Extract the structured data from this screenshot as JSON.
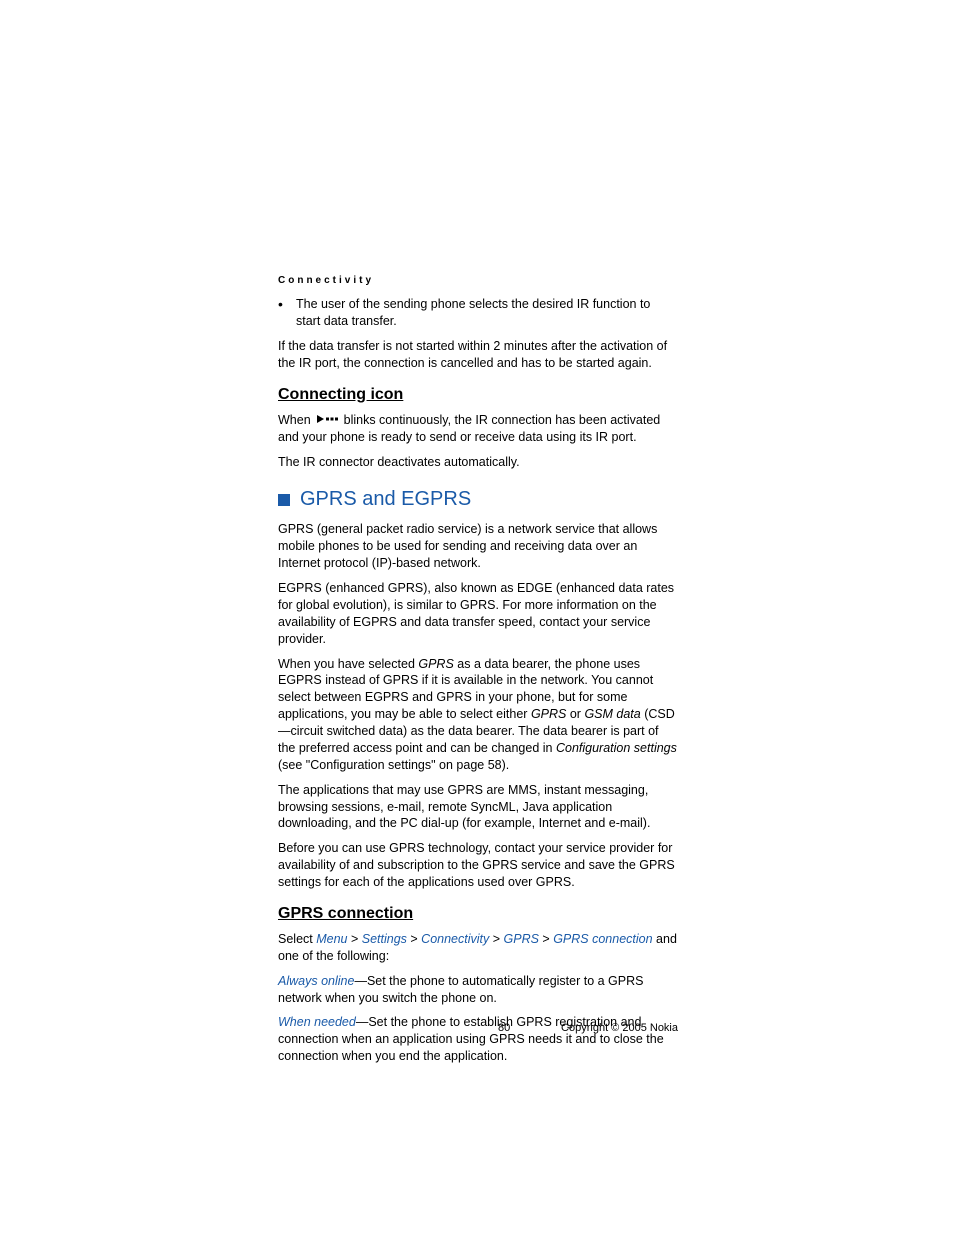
{
  "running_head": "Connectivity",
  "bullet1": "The user of the sending phone selects the desired IR function to start data transfer.",
  "para_if": "If the data transfer is not started within 2 minutes after the activation of the IR port, the connection is cancelled and has to be started again.",
  "h2_connecting": "Connecting icon",
  "conn_when_pre": "When ",
  "conn_when_post": " blinks continuously, the IR connection has been activated and your phone is ready to send or receive data using its IR port.",
  "conn_deact": "The IR connector deactivates automatically.",
  "h1_gprs": "GPRS and EGPRS",
  "gprs_p1": "GPRS (general packet radio service) is a network service that allows mobile phones to be used for sending and receiving data over an Internet protocol (IP)-based network.",
  "gprs_p2": "EGPRS (enhanced GPRS), also known as EDGE (enhanced data rates for global evolution), is similar to GPRS. For more information on the availability of EGPRS and data transfer speed, contact your service provider.",
  "gprs_p3_a": "When you have selected ",
  "gprs_p3_gprs": "GPRS",
  "gprs_p3_b": " as a data bearer, the phone uses EGPRS instead of GPRS if it is available in the network. You cannot select between EGPRS and GPRS in your phone, but for some applications, you may be able to select either ",
  "gprs_p3_gprs2": "GPRS",
  "gprs_p3_c": " or ",
  "gprs_p3_gsm": "GSM data",
  "gprs_p3_d": " (CSD—circuit switched data) as the data bearer. The data bearer is part of the preferred access point and can be changed in ",
  "gprs_p3_conf": "Configuration settings",
  "gprs_p3_e": " (see \"Configuration settings\" on page 58).",
  "gprs_p4": "The applications that may use GPRS are MMS, instant messaging, browsing sessions, e-mail, remote SyncML, Java application downloading, and the PC dial-up (for example, Internet and e-mail).",
  "gprs_p5": "Before you can use GPRS technology, contact your service provider for availability of and subscription to the GPRS service and save the GPRS settings for each of the applications used over GPRS.",
  "h2_gprsconn": "GPRS connection",
  "sel_pre": "Select ",
  "sel_menu": "Menu",
  "sel_gt": " > ",
  "sel_settings": "Settings",
  "sel_connectivity": "Connectivity",
  "sel_gprs": "GPRS",
  "sel_gprsconn": "GPRS connection",
  "sel_post": " and one of the following:",
  "always_lbl": "Always online",
  "always_txt": "—Set the phone to automatically register to a GPRS network when you switch the phone on.",
  "when_lbl": "When needed",
  "when_txt": "—Set the phone to establish GPRS registration and connection when an application using GPRS needs it and to close the connection when you end the application.",
  "footer_page": "80",
  "footer_copy": "Copyright © 2005 Nokia"
}
